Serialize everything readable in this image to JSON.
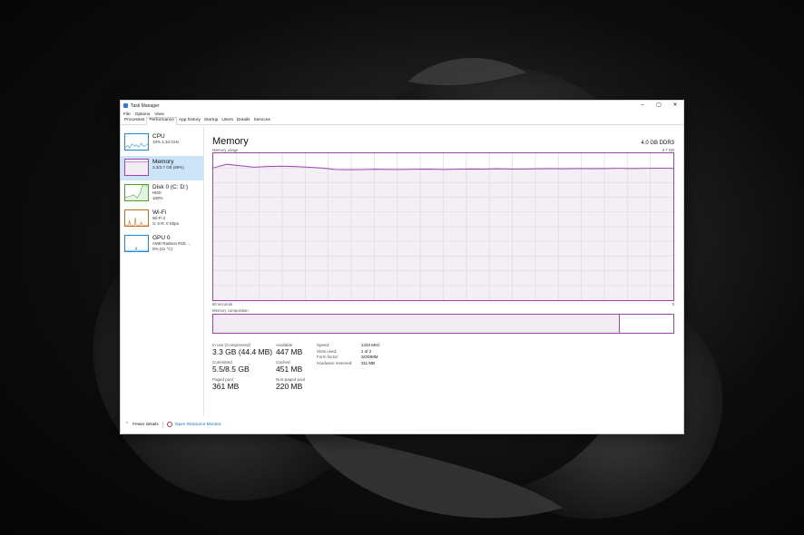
{
  "window": {
    "title": "Task Manager",
    "controls": [
      "–",
      "▢",
      "✕"
    ]
  },
  "menu": [
    "File",
    "Options",
    "View"
  ],
  "tabs": [
    {
      "label": "Processes",
      "active": false
    },
    {
      "label": "Performance",
      "active": true
    },
    {
      "label": "App history",
      "active": false
    },
    {
      "label": "Startup",
      "active": false
    },
    {
      "label": "Users",
      "active": false
    },
    {
      "label": "Details",
      "active": false
    },
    {
      "label": "Services",
      "active": false
    }
  ],
  "sidebar": {
    "items": [
      {
        "name": "CPU",
        "line1": "10% 1.34 GHz",
        "line2": "",
        "color": "#1a8ad6",
        "selected": false
      },
      {
        "name": "Memory",
        "line1": "3.3/3.7 GB (89%)",
        "line2": "",
        "color": "#a043b2",
        "selected": true
      },
      {
        "name": "Disk 0 (C: D:)",
        "line1": "HDD",
        "line2": "100%",
        "color": "#4aa02c",
        "selected": false
      },
      {
        "name": "Wi-Fi",
        "line1": "Wi-Fi 2",
        "line2": "S: 0 R: 0 Kbps",
        "color": "#c66a1b",
        "selected": false
      },
      {
        "name": "GPU 0",
        "line1": "AMD Radeon R1E ...",
        "line2": "0% (41 °C)",
        "color": "#1a8ad6",
        "selected": false
      }
    ]
  },
  "main": {
    "title": "Memory",
    "capacity": "4.0 GB DDR3",
    "usage_label": "Memory usage",
    "usage_max": "3.7 GB",
    "time_label": "60 seconds",
    "time_end": "0",
    "composition_label": "Memory composition",
    "composition_in_use_fraction": 0.884,
    "usage_series_fraction": [
      0.9,
      0.925,
      0.915,
      0.905,
      0.91,
      0.912,
      0.91,
      0.905,
      0.9,
      0.89,
      0.888,
      0.889,
      0.891,
      0.89,
      0.89,
      0.891,
      0.892,
      0.89,
      0.891,
      0.893,
      0.892,
      0.894,
      0.893,
      0.893,
      0.894,
      0.895,
      0.894,
      0.896,
      0.895,
      0.896,
      0.897,
      0.896,
      0.897,
      0.898,
      0.897
    ]
  },
  "stats": {
    "in_use_label": "In use (Compressed)",
    "in_use": "3.3 GB (44.4 MB)",
    "available_label": "Available",
    "available": "447 MB",
    "committed_label": "Committed",
    "committed": "5.5/8.5 GB",
    "cached_label": "Cached",
    "cached": "451 MB",
    "paged_label": "Paged pool",
    "paged": "361 MB",
    "nonpaged_label": "Non-paged pool",
    "nonpaged": "220 MB"
  },
  "details": [
    {
      "k": "Speed:",
      "v": "1333 MHz"
    },
    {
      "k": "Slots used:",
      "v": "1 of 2"
    },
    {
      "k": "Form factor:",
      "v": "SODIMM"
    },
    {
      "k": "Hardware reserved:",
      "v": "311 MB"
    }
  ],
  "footer": {
    "fewer": "Fewer details",
    "monitor": "Open Resource Monitor"
  },
  "colors": {
    "memory": "#a043b2",
    "memory_fill": "#f1ecf2",
    "link": "#1a6fc0",
    "selection": "#cce4f7"
  }
}
